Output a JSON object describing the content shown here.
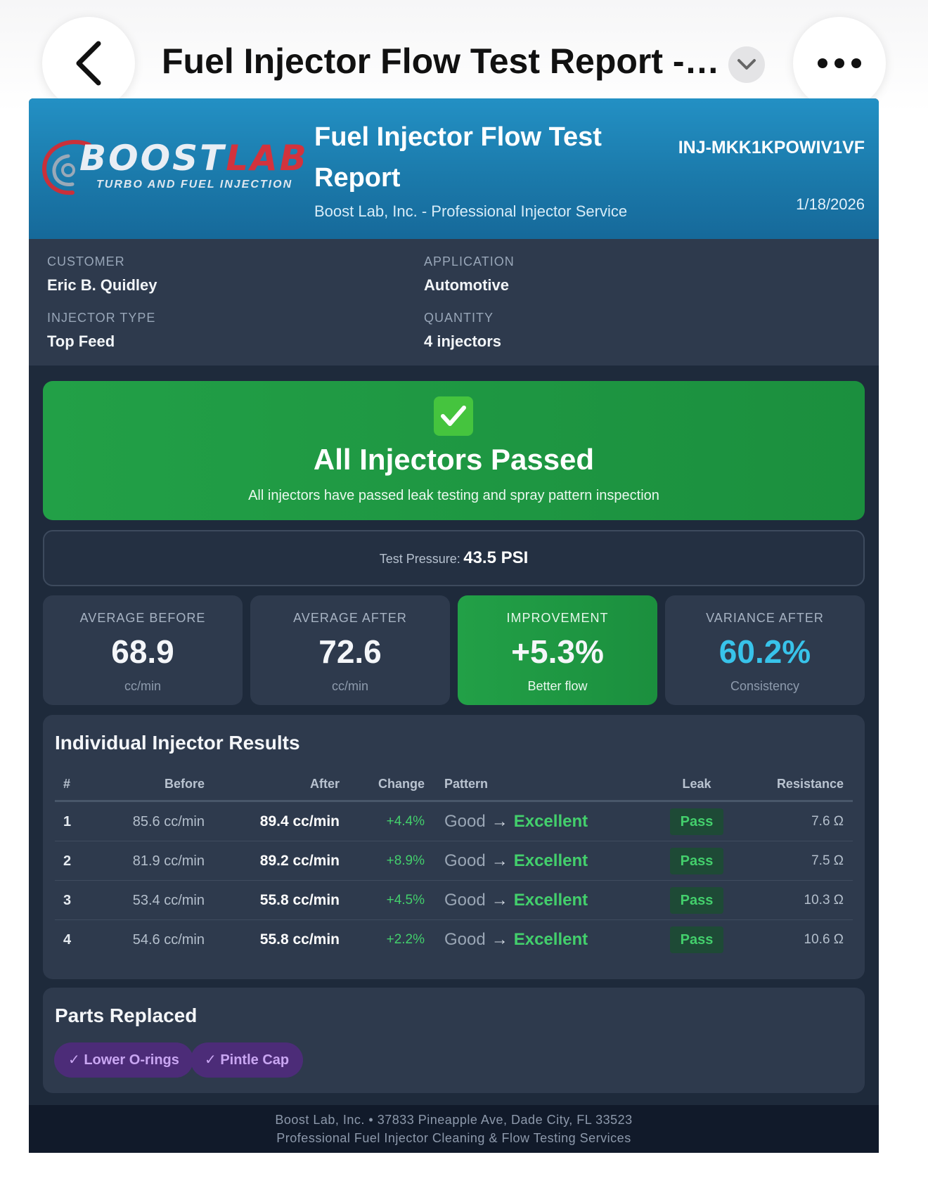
{
  "window": {
    "title": "Fuel Injector Flow Test Report -…"
  },
  "header": {
    "logo": {
      "brand_a": "BOOST",
      "brand_b": "LAB",
      "tagline": "TURBO AND FUEL INJECTION"
    },
    "title": "Fuel Injector Flow Test Report",
    "subtitle": "Boost Lab, Inc. - Professional Injector Service",
    "report_id": "INJ-MKK1KPOWIV1VF",
    "date": "1/18/2026"
  },
  "info": {
    "customer": {
      "label": "CUSTOMER",
      "value": "Eric B. Quidley"
    },
    "application": {
      "label": "APPLICATION",
      "value": "Automotive"
    },
    "injector_type": {
      "label": "INJECTOR TYPE",
      "value": "Top Feed"
    },
    "quantity": {
      "label": "QUANTITY",
      "value": "4 injectors"
    }
  },
  "status": {
    "icon": "check-mark-icon",
    "title": "All Injectors Passed",
    "subtitle": "All injectors have passed leak testing and spray pattern inspection",
    "color": "#22a047"
  },
  "pressure": {
    "label": "Test Pressure:",
    "value": "43.5 PSI"
  },
  "stats": [
    {
      "label": "AVERAGE BEFORE",
      "value": "68.9",
      "unit": "cc/min"
    },
    {
      "label": "AVERAGE AFTER",
      "value": "72.6",
      "unit": "cc/min"
    },
    {
      "label": "IMPROVEMENT",
      "value": "+5.3%",
      "unit": "Better flow"
    },
    {
      "label": "VARIANCE AFTER",
      "value": "60.2%",
      "unit": "Consistency",
      "color": "#38c3ea"
    }
  ],
  "results": {
    "title": "Individual Injector Results",
    "columns": [
      "#",
      "Before",
      "After",
      "Change",
      "Pattern",
      "Leak",
      "Resistance"
    ],
    "rows": [
      {
        "num": "1",
        "before": "85.6 cc/min",
        "after": "89.4 cc/min",
        "change": "+4.4%",
        "pattern_before": "Good",
        "pattern_after": "Excellent",
        "leak": "Pass",
        "resistance": "7.6 Ω"
      },
      {
        "num": "2",
        "before": "81.9 cc/min",
        "after": "89.2 cc/min",
        "change": "+8.9%",
        "pattern_before": "Good",
        "pattern_after": "Excellent",
        "leak": "Pass",
        "resistance": "7.5 Ω"
      },
      {
        "num": "3",
        "before": "53.4 cc/min",
        "after": "55.8 cc/min",
        "change": "+4.5%",
        "pattern_before": "Good",
        "pattern_after": "Excellent",
        "leak": "Pass",
        "resistance": "10.3 Ω"
      },
      {
        "num": "4",
        "before": "54.6 cc/min",
        "after": "55.8 cc/min",
        "change": "+2.2%",
        "pattern_before": "Good",
        "pattern_after": "Excellent",
        "leak": "Pass",
        "resistance": "10.6 Ω"
      }
    ]
  },
  "parts": {
    "title": "Parts Replaced",
    "items": [
      "✓ Lower O-rings",
      "✓ Pintle Cap"
    ]
  },
  "footer": {
    "line1": "Boost Lab, Inc. • 37833 Pineapple Ave, Dade City, FL 33523",
    "line2": "Professional Fuel Injector Cleaning & Flow Testing Services"
  },
  "icons": {
    "back": "chevron-left-icon",
    "dropdown": "chevron-down-icon",
    "more": "more-horizontal-icon",
    "arrow": "arrow-right-icon"
  }
}
